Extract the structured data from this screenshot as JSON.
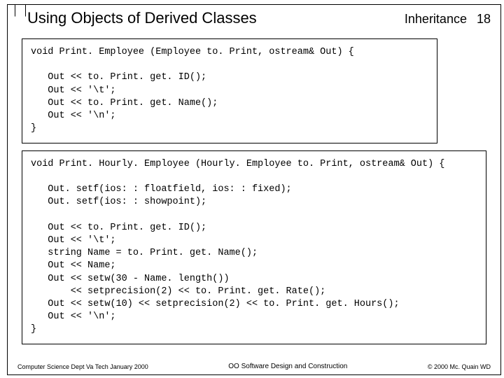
{
  "header": {
    "title": "Using Objects of Derived Classes",
    "category": "Inheritance",
    "page": "18"
  },
  "code1": "void Print. Employee (Employee to. Print, ostream& Out) {\n\n   Out << to. Print. get. ID();\n   Out << '\\t';\n   Out << to. Print. get. Name();\n   Out << '\\n';\n}",
  "code2": "void Print. Hourly. Employee (Hourly. Employee to. Print, ostream& Out) {\n\n   Out. setf(ios: : floatfield, ios: : fixed);\n   Out. setf(ios: : showpoint);\n\n   Out << to. Print. get. ID();\n   Out << '\\t';\n   string Name = to. Print. get. Name();\n   Out << Name;\n   Out << setw(30 - Name. length())\n       << setprecision(2) << to. Print. get. Rate();\n   Out << setw(10) << setprecision(2) << to. Print. get. Hours();\n   Out << '\\n';\n}",
  "footer": {
    "left": "Computer Science Dept Va Tech January 2000",
    "mid": "OO Software Design and Construction",
    "right": "© 2000 Mc. Quain WD"
  }
}
